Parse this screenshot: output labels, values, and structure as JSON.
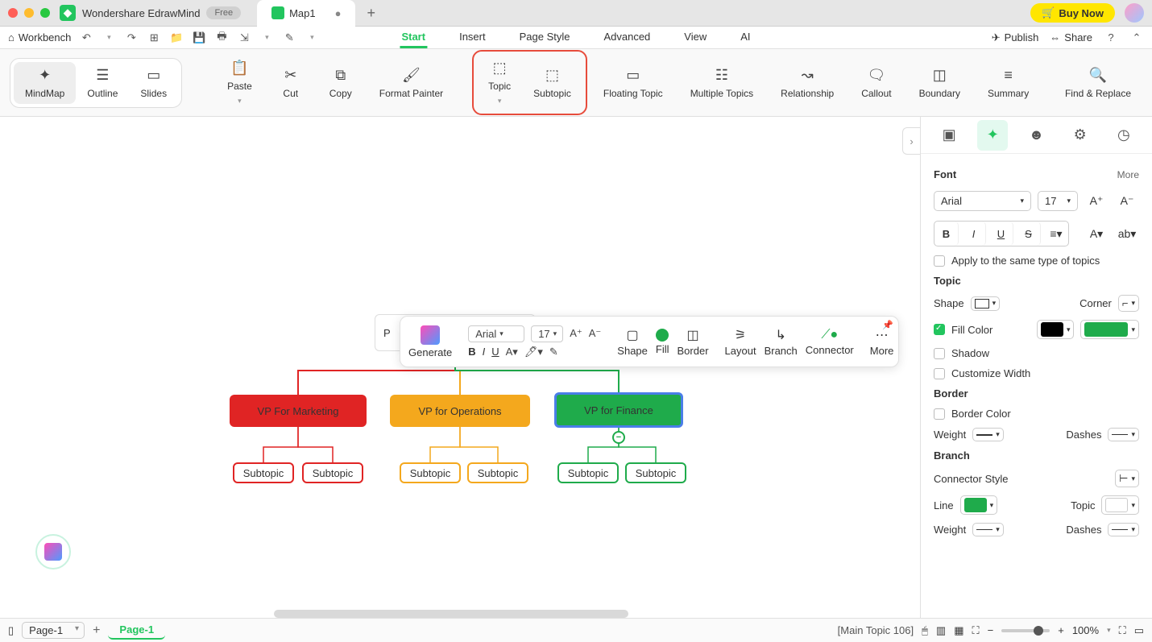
{
  "titlebar": {
    "app_name": "Wondershare EdrawMind",
    "badge": "Free",
    "tab_name": "Map1",
    "buy": "Buy Now"
  },
  "menubar": {
    "workbench": "Workbench",
    "tabs": [
      "Start",
      "Insert",
      "Page Style",
      "Advanced",
      "View",
      "AI"
    ],
    "publish": "Publish",
    "share": "Share"
  },
  "ribbon": {
    "mindmap": "MindMap",
    "outline": "Outline",
    "slides": "Slides",
    "paste": "Paste",
    "cut": "Cut",
    "copy": "Copy",
    "fmt": "Format Painter",
    "topic": "Topic",
    "subtopic": "Subtopic",
    "floating": "Floating Topic",
    "multiple": "Multiple Topics",
    "relationship": "Relationship",
    "callout": "Callout",
    "boundary": "Boundary",
    "summary": "Summary",
    "find": "Find & Replace"
  },
  "canvas": {
    "root": "P",
    "vp1": "VP For Marketing",
    "vp2": "VP for Operations",
    "vp3": "VP for Finance",
    "sub": "Subtopic"
  },
  "float": {
    "generate": "Generate",
    "font": "Arial",
    "size": "17",
    "shape": "Shape",
    "fill": "Fill",
    "border": "Border",
    "layout": "Layout",
    "branch": "Branch",
    "connector": "Connector",
    "more": "More"
  },
  "panel": {
    "font_h": "Font",
    "more": "More",
    "font": "Arial",
    "size": "17",
    "apply": "Apply to the same type of topics",
    "topic_h": "Topic",
    "shape": "Shape",
    "corner": "Corner",
    "fillcolor": "Fill Color",
    "shadow": "Shadow",
    "custw": "Customize Width",
    "border_h": "Border",
    "bcolor": "Border Color",
    "weight": "Weight",
    "dashes": "Dashes",
    "branch_h": "Branch",
    "cstyle": "Connector Style",
    "line": "Line",
    "topic": "Topic"
  },
  "status": {
    "page_sel": "Page-1",
    "page_tab": "Page-1",
    "selection": "[Main Topic 106]",
    "zoom": "100%"
  }
}
